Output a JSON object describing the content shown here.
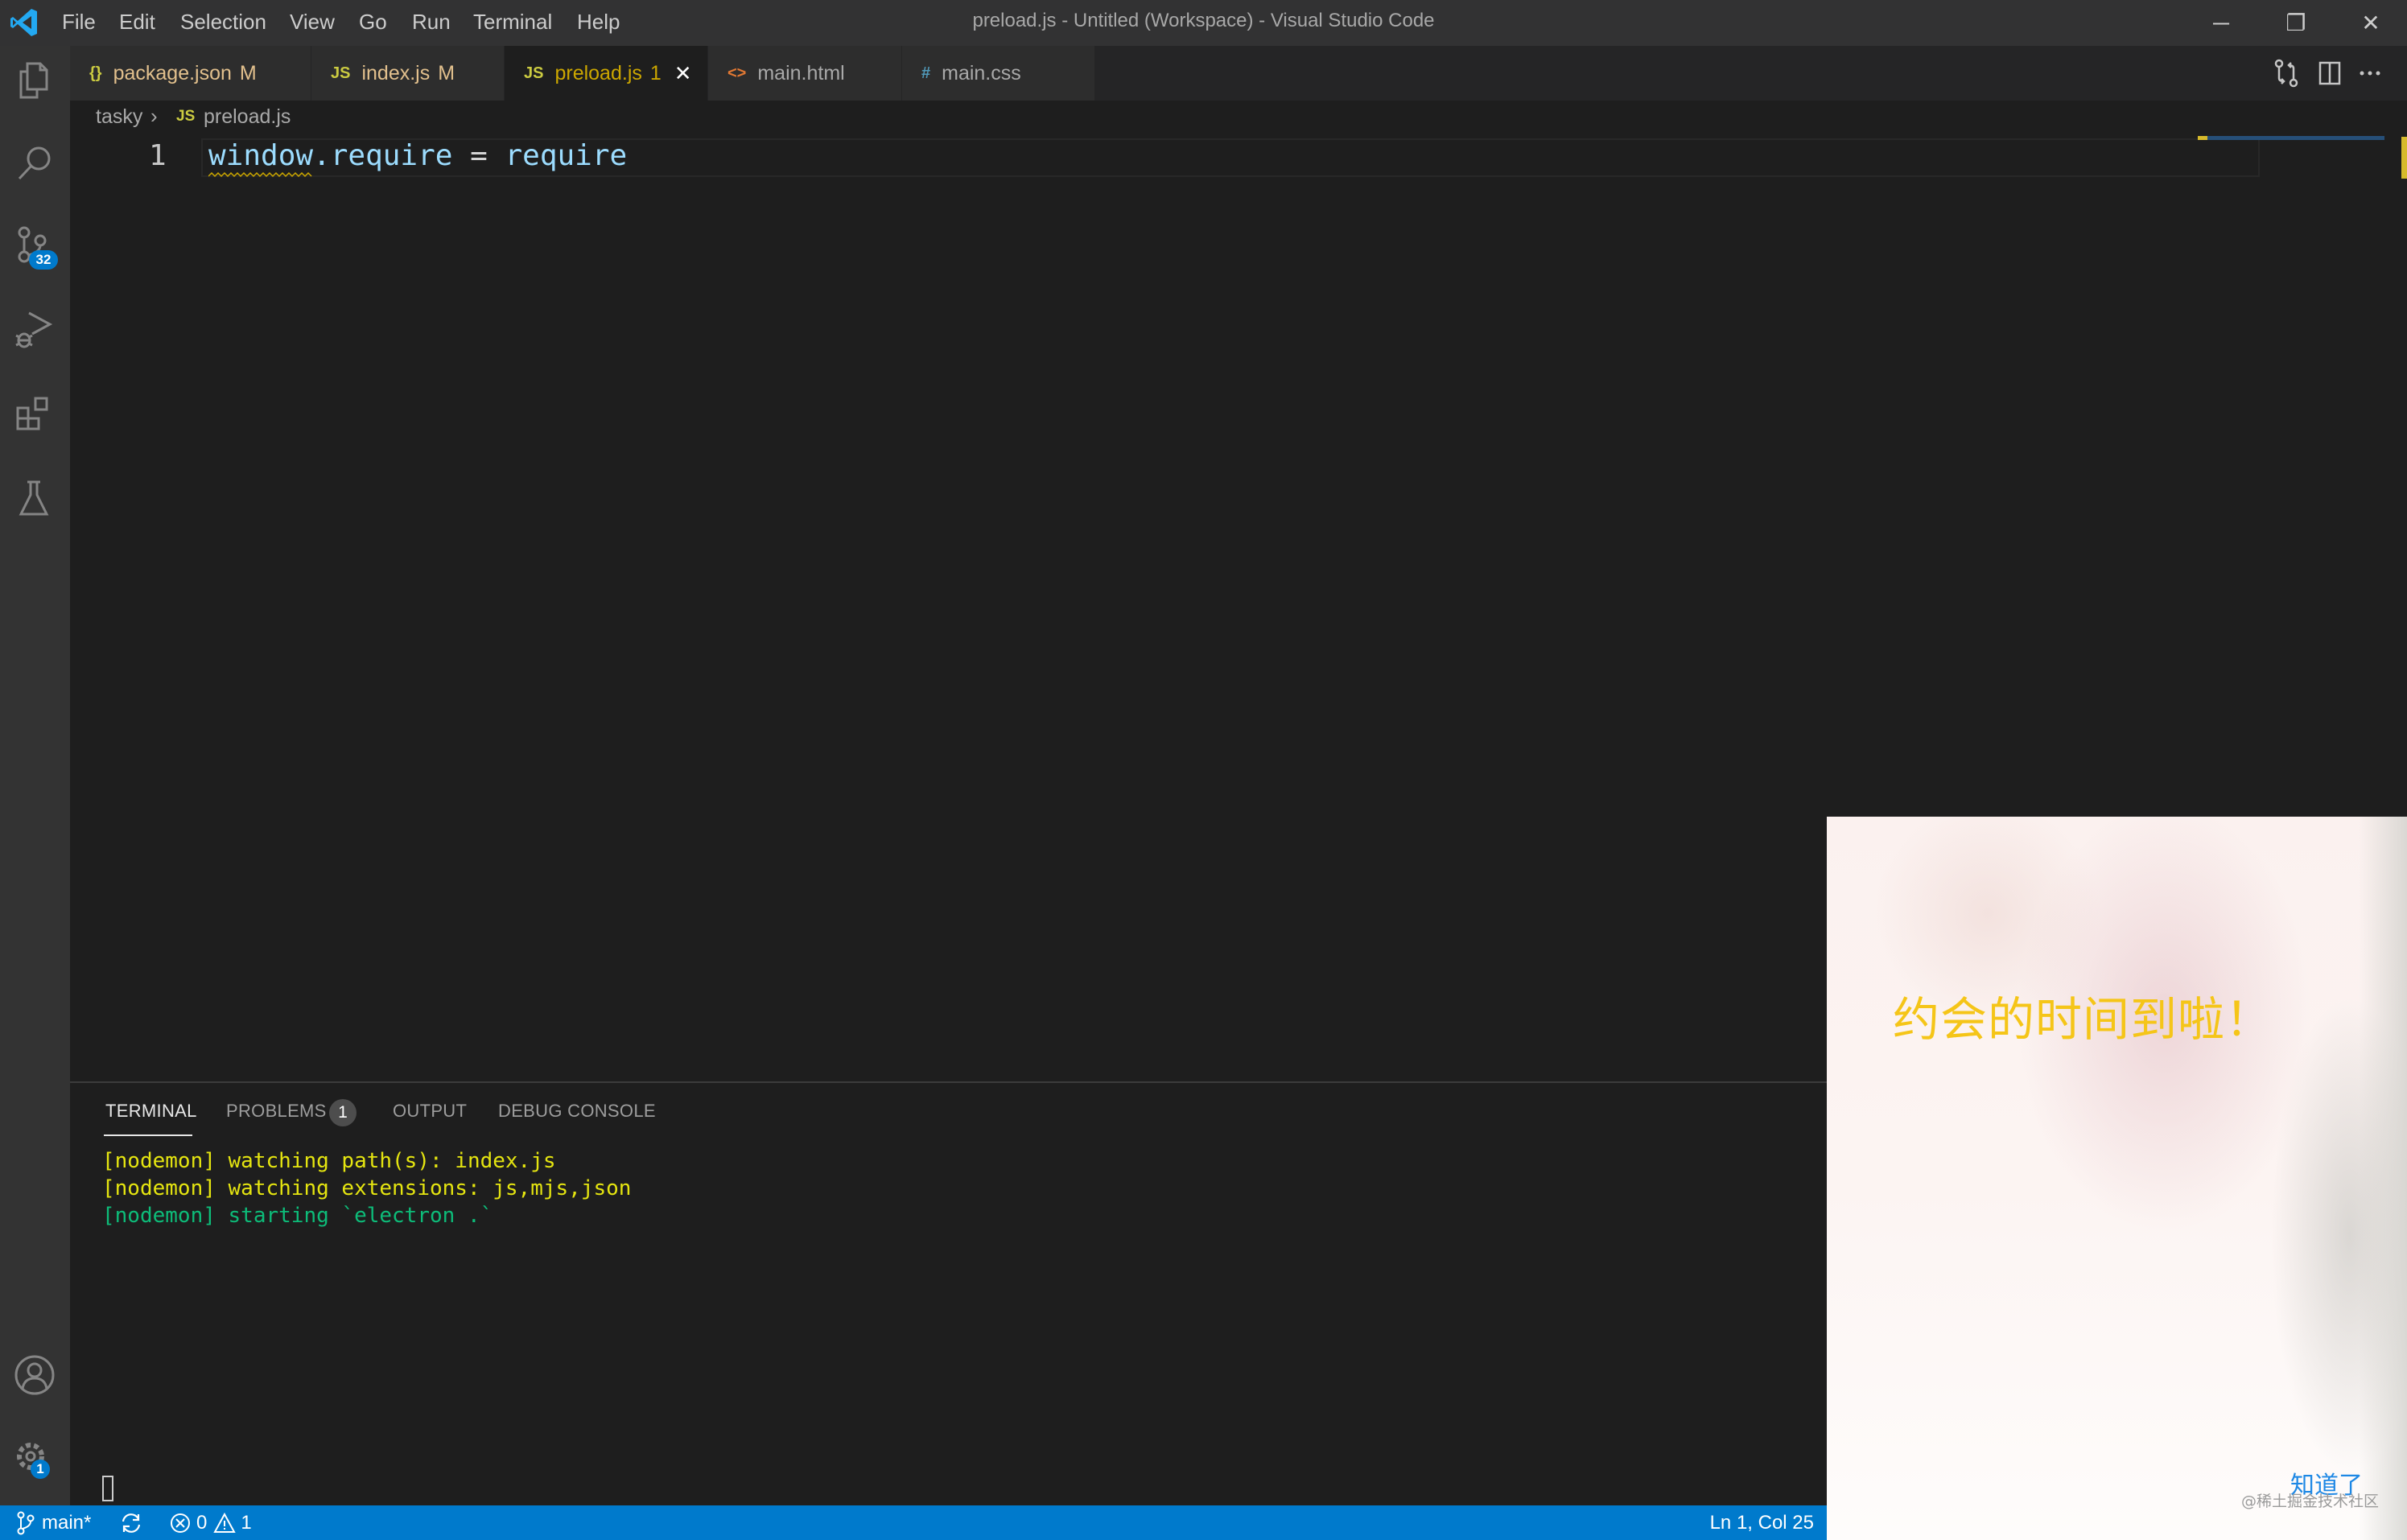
{
  "titlebar": {
    "app_icon": "vscode-logo-icon",
    "menu": [
      "File",
      "Edit",
      "Selection",
      "View",
      "Go",
      "Run",
      "Terminal",
      "Help"
    ],
    "window_title": "preload.js - Untitled (Workspace) - Visual Studio Code",
    "controls": {
      "minimize": "─",
      "restore": "❐",
      "close": "✕"
    }
  },
  "activitybar": {
    "items": [
      {
        "name": "explorer",
        "icon": "files-icon"
      },
      {
        "name": "search",
        "icon": "search-icon"
      },
      {
        "name": "source-control",
        "icon": "source-control-icon",
        "badge": "32"
      },
      {
        "name": "run-debug",
        "icon": "run-debug-icon"
      },
      {
        "name": "extensions",
        "icon": "extensions-icon"
      },
      {
        "name": "testing",
        "icon": "beaker-icon"
      }
    ],
    "bottom": [
      {
        "name": "accounts",
        "icon": "account-icon"
      },
      {
        "name": "manage",
        "icon": "gear-icon",
        "badge": "1"
      }
    ]
  },
  "tabs": [
    {
      "icon_text": "{}",
      "icon": "json-icon",
      "label": "package.json",
      "status": "M",
      "active": false
    },
    {
      "icon_text": "JS",
      "icon": "js-icon",
      "label": "index.js",
      "status": "M",
      "active": false
    },
    {
      "icon_text": "JS",
      "icon": "js-icon",
      "label": "preload.js",
      "status": "1",
      "active": true,
      "close": "✕"
    },
    {
      "icon_text": "<>",
      "icon": "html-icon",
      "label": "main.html",
      "status": "",
      "active": false
    },
    {
      "icon_text": "#",
      "icon": "css-icon",
      "label": "main.css",
      "status": "",
      "active": false
    }
  ],
  "tab_actions": [
    "open-changes-icon",
    "split-editor-icon",
    "more-actions-icon"
  ],
  "breadcrumb": {
    "folder": "tasky",
    "separator": "›",
    "file_icon": "JS",
    "file": "preload.js"
  },
  "editor": {
    "lines": [
      {
        "number": "1",
        "tokens": {
          "a": "window",
          "b": ".require",
          "c": " = ",
          "d": "require"
        }
      }
    ]
  },
  "panel": {
    "tabs": [
      {
        "label": "TERMINAL",
        "active": true
      },
      {
        "label": "PROBLEMS",
        "badge": "1"
      },
      {
        "label": "OUTPUT"
      },
      {
        "label": "DEBUG CONSOLE"
      }
    ],
    "terminal_lines": [
      {
        "text": "[nodemon] watching path(s): index.js",
        "color": "#e5e510"
      },
      {
        "text": "[nodemon] watching extensions: js,mjs,json",
        "color": "#e5e510"
      },
      {
        "text": "[nodemon] starting `electron .`",
        "color": "#0dbc79"
      }
    ]
  },
  "statusbar": {
    "branch": "main*",
    "sync_icon": "sync-icon",
    "errors": "0",
    "warnings": "1",
    "cursor_position": "Ln 1, Col 25"
  },
  "notification": {
    "message": "约会的时间到啦！",
    "button": "知道了",
    "watermark": "@稀土掘金技术社区"
  },
  "colors": {
    "accent": "#007acc",
    "message": "#f5c518",
    "button": "#1e88e5"
  }
}
